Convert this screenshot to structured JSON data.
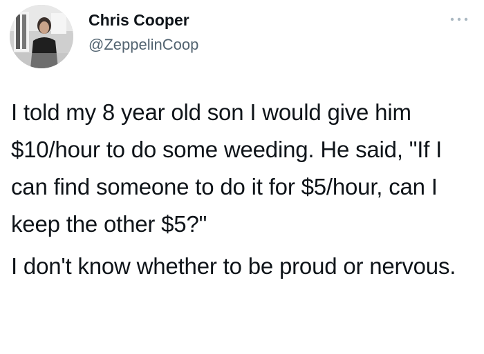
{
  "author": {
    "display_name": "Chris Cooper",
    "handle": "@ZeppelinCoop"
  },
  "menu": {
    "icon": "more-horizontal-icon"
  },
  "tweet": {
    "paragraphs": [
      "I told my 8 year old son I would give him $10/hour to do some weeding. He said, \"If I can find someone to do it for $5/hour, can I keep the other $5?\"",
      "I don't know whether to be proud or nervous."
    ]
  },
  "colors": {
    "name": "#0f1419",
    "handle": "#536471",
    "background": "#ffffff"
  }
}
